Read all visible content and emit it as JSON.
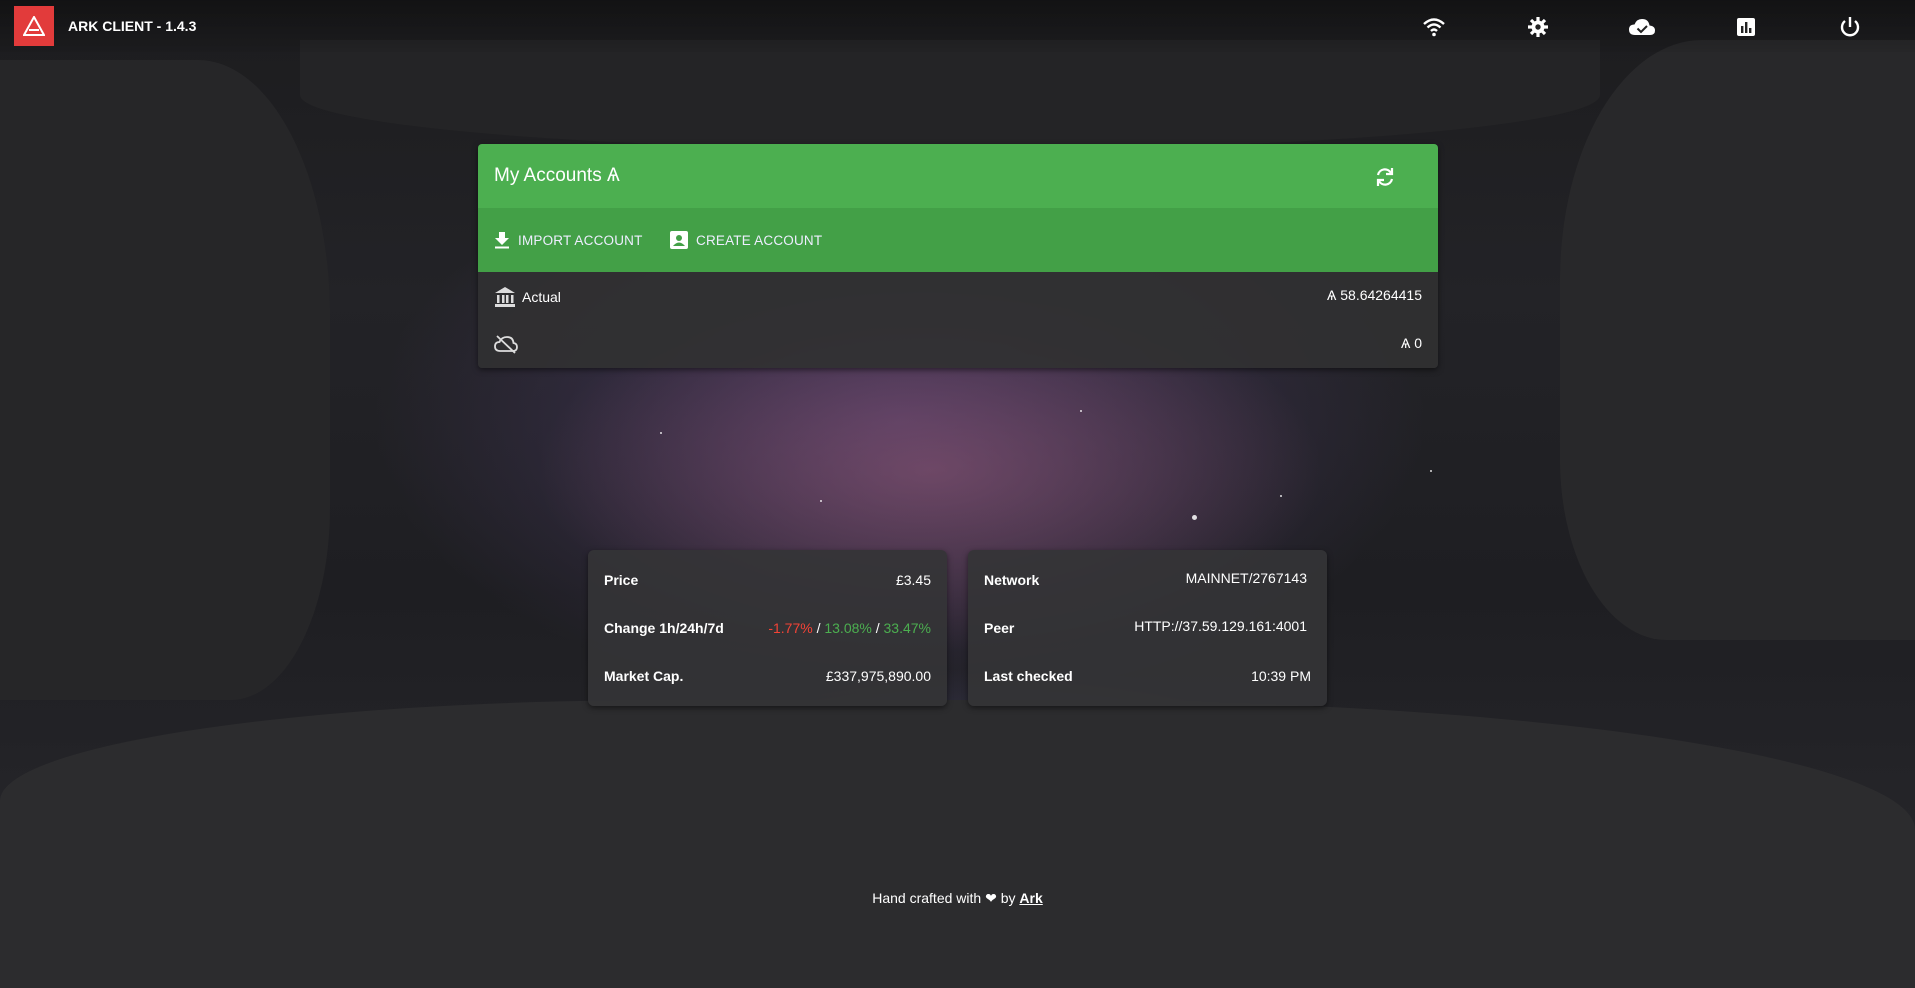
{
  "app": {
    "title": "ARK CLIENT - 1.4.3",
    "accent": "#e23b3b"
  },
  "topbar": {
    "icons": [
      "wifi-icon",
      "gear-icon",
      "cloud-icon",
      "chart-icon",
      "power-icon"
    ]
  },
  "accounts": {
    "title": "My Accounts Ѧ",
    "header_color": "#4caf50",
    "actions": {
      "import_label": "IMPORT ACCOUNT",
      "create_label": "CREATE ACCOUNT"
    },
    "rows": [
      {
        "label": "Actual",
        "balance": "Ѧ 58.64264415",
        "icon": "bank-icon"
      },
      {
        "label": "",
        "balance": "Ѧ 0",
        "icon": "cloud-off-icon"
      }
    ]
  },
  "market": {
    "price_label": "Price",
    "price_value": "£3.45",
    "change_label": "Change 1h/24h/7d",
    "change_1h": "-1.77%",
    "change_24h": "13.08%",
    "change_7d": "33.47%",
    "marketcap_label": "Market Cap.",
    "marketcap_value": "£337,975,890.00"
  },
  "network": {
    "network_label": "Network",
    "network_value": "MAINNET/2767143",
    "peer_label": "Peer",
    "peer_value": "HTTP://37.59.129.161:4001",
    "checked_label": "Last checked",
    "checked_value": "10:39 PM"
  },
  "footer": {
    "prefix": "Hand crafted with",
    "heart": "❤",
    "by": "by",
    "link": "Ark"
  }
}
